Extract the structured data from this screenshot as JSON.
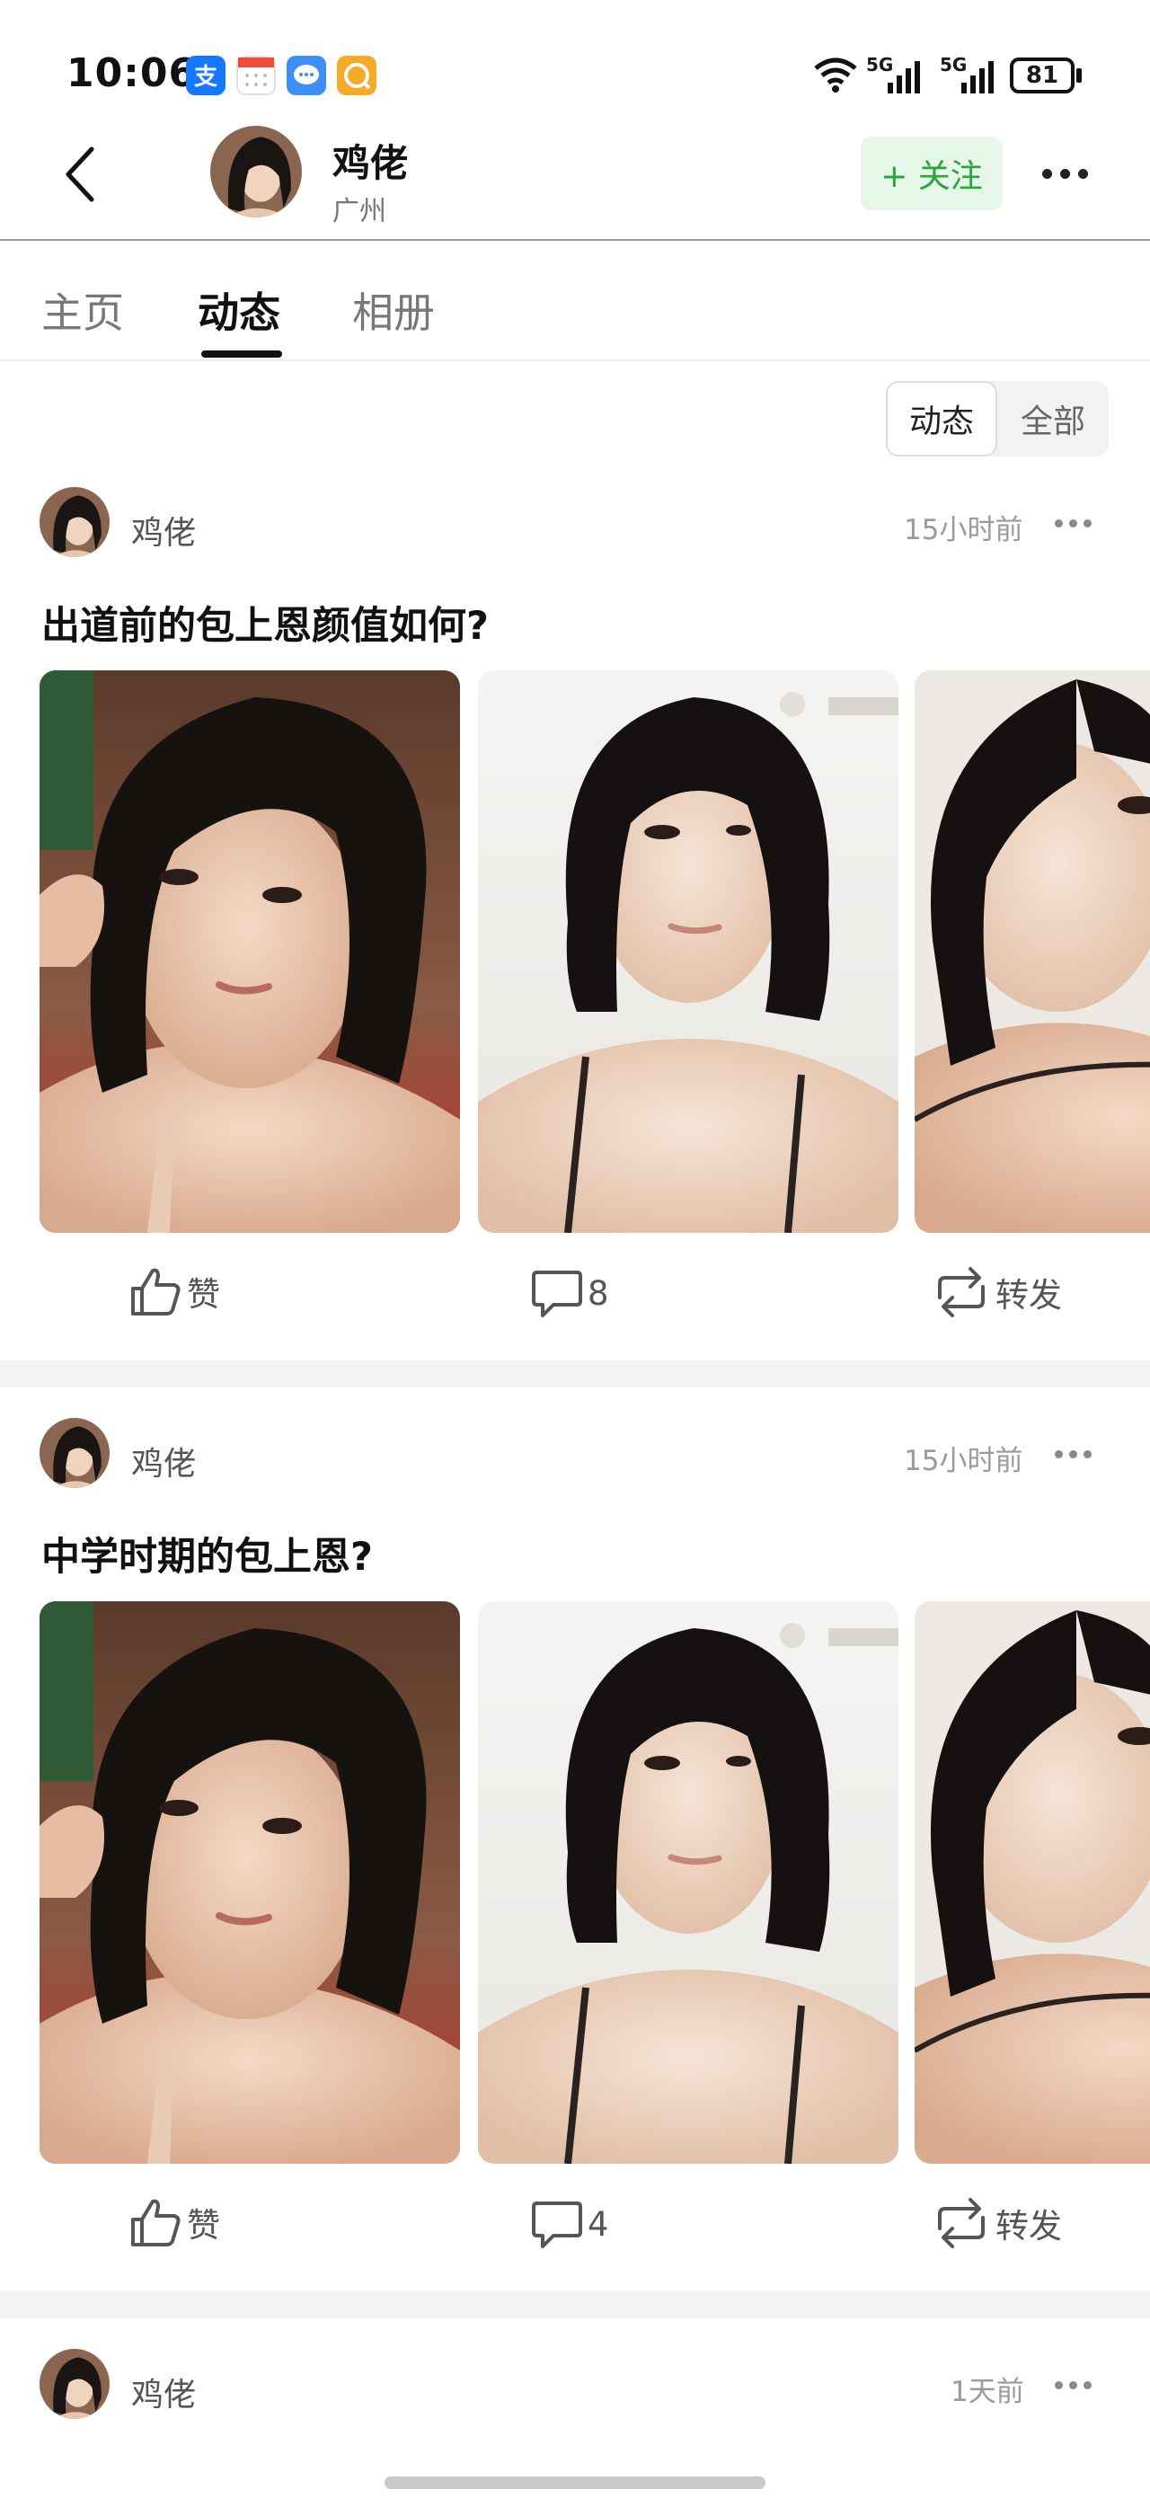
{
  "status_bar": {
    "time": "10:06",
    "battery": "81",
    "signal_label_1": "5G",
    "signal_label_2": "5G",
    "app_icons": [
      "alipay-icon",
      "calendar-icon",
      "message-icon",
      "browser-icon"
    ]
  },
  "header": {
    "name": "鸡佬",
    "location": "广州",
    "follow_label": "+ 关注"
  },
  "tabs": [
    {
      "label": "主页",
      "active": false
    },
    {
      "label": "动态",
      "active": true
    },
    {
      "label": "相册",
      "active": false
    }
  ],
  "filter": {
    "options": [
      "动态",
      "全部"
    ],
    "selected": "动态"
  },
  "posts": [
    {
      "author": "鸡佬",
      "time": "15小时前",
      "title": "出道前的包上恩颜值如何?",
      "like_label": "赞",
      "comment_count": "8",
      "repost_label": "转发"
    },
    {
      "author": "鸡佬",
      "time": "15小时前",
      "title": "中学时期的包上恩?",
      "like_label": "赞",
      "comment_count": "4",
      "repost_label": "转发"
    },
    {
      "author": "鸡佬",
      "time": "1天前"
    }
  ],
  "colors": {
    "accent_green": "#2aa53a",
    "follow_bg": "#e6f6e9",
    "separator": "#f3f3f3"
  }
}
